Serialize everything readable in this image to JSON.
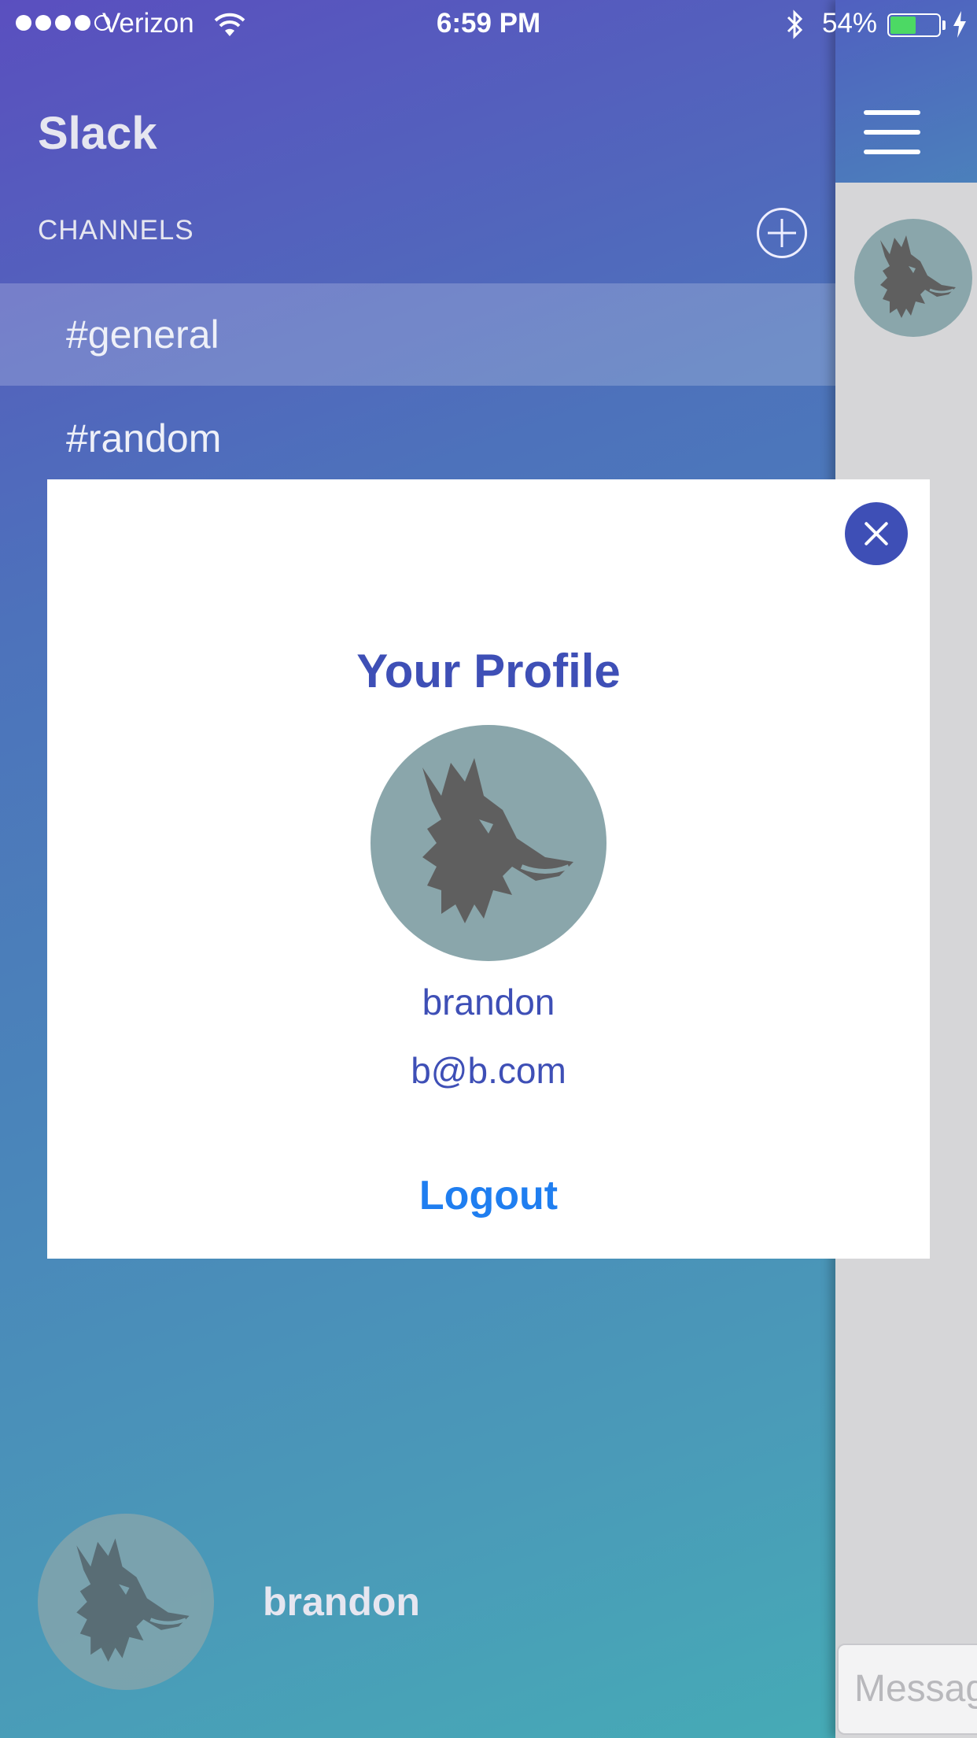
{
  "status_bar": {
    "carrier": "Verizon",
    "time": "6:59 PM",
    "battery": "54%",
    "battery_level": 0.54,
    "signal_icon": "signal-dots-icon",
    "wifi_icon": "wifi-icon",
    "bluetooth_icon": "bluetooth-icon",
    "charging_icon": "bolt-icon"
  },
  "sidebar": {
    "title": "Slack",
    "channels_label": "CHANNELS",
    "channels": [
      {
        "name": "#general",
        "selected": true
      },
      {
        "name": "#random",
        "selected": false
      }
    ],
    "user": {
      "name": "brandon",
      "avatar_icon": "wolf-avatar-icon"
    }
  },
  "main": {
    "menu_icon": "hamburger-icon",
    "message_placeholder": "Message"
  },
  "profile_modal": {
    "title": "Your Profile",
    "name": "brandon",
    "email": "b@b.com",
    "logout_label": "Logout",
    "close_icon": "close-icon"
  },
  "colors": {
    "accent": "#3e4fb6",
    "logout": "#1f7ef0",
    "avatar_bg": "#8aa6ab",
    "gradient_top": "#5a4fbf",
    "gradient_bottom": "#45adb6"
  }
}
